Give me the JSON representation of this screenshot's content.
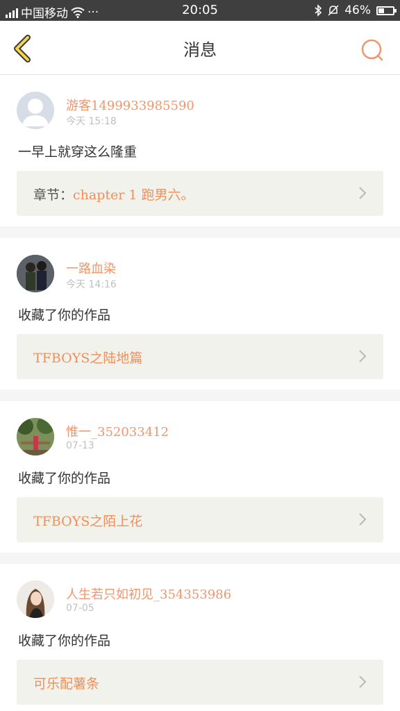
{
  "status_bar": {
    "carrier": "中国移动",
    "dots": "···",
    "time": "20:05",
    "battery": "46%",
    "battery_level": 0.46
  },
  "header": {
    "title": "消息",
    "back_icon": "chevron-left-icon",
    "search_icon": "search-icon"
  },
  "messages": [
    {
      "user": "游客1499933985590",
      "time": "今天 15:18",
      "text": "一早上就穿这么隆重",
      "link_prefix": "章节：",
      "link": "chapter 1 跑男六。",
      "avatar": "default-avatar"
    },
    {
      "user": "一路血染",
      "time": "今天 14:16",
      "text": "收藏了你的作品",
      "link_prefix": "",
      "link": "TFBOYS之陆地篇",
      "avatar": "photo-avatar"
    },
    {
      "user": "惟一_352033412",
      "time": "07-13",
      "text": "收藏了你的作品",
      "link_prefix": "",
      "link": "TFBOYS之陌上花",
      "avatar": "photo-avatar"
    },
    {
      "user": "人生若只如初见_354353986",
      "time": "07-05",
      "text": "收藏了你的作品",
      "link_prefix": "",
      "link": "可乐配薯条",
      "avatar": "photo-avatar"
    }
  ],
  "colors": {
    "accent": "#f2956a",
    "status_bar": "#3f3f3f",
    "link_box": "#f2f2ec"
  }
}
